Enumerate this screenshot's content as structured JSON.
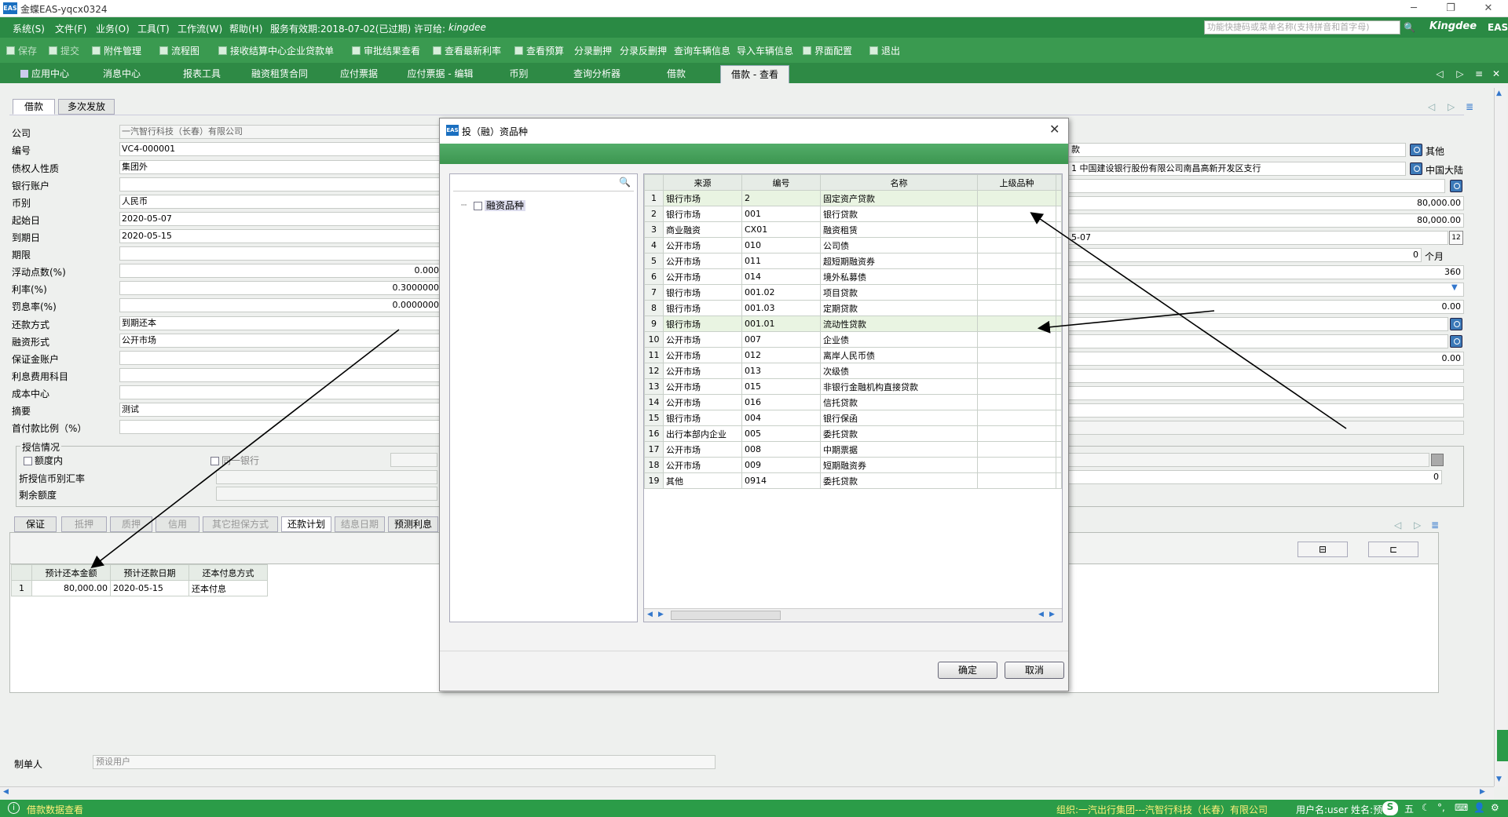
{
  "window": {
    "title": "金蝶EAS-yqcx0324"
  },
  "menu": {
    "items": [
      "系统(S)",
      "文件(F)",
      "业务(O)",
      "工具(T)",
      "工作流(W)",
      "帮助(H)"
    ],
    "service": "服务有效期:2018-07-02(已过期) 许可给:",
    "licensee": "kingdee",
    "search_placeholder": "功能快捷码或菜单名称(支持拼音和首字母)",
    "brand": "Kingdee",
    "brand_suffix": "EAS"
  },
  "toolbar": {
    "items": [
      {
        "label": "保存",
        "enabled": false
      },
      {
        "label": "提交",
        "enabled": false
      },
      {
        "label": "附件管理",
        "enabled": true
      },
      {
        "label": "流程图",
        "enabled": true
      },
      {
        "label": "接收结算中心企业贷款单",
        "enabled": true
      },
      {
        "label": "审批结果查看",
        "enabled": true
      },
      {
        "label": "查看最新利率",
        "enabled": true
      },
      {
        "label": "查看预算",
        "enabled": true
      },
      {
        "label": "分录删押",
        "enabled": true
      },
      {
        "label": "分录反删押",
        "enabled": true
      },
      {
        "label": "查询车辆信息",
        "enabled": true
      },
      {
        "label": "导入车辆信息",
        "enabled": true
      },
      {
        "label": "界面配置",
        "enabled": true
      },
      {
        "label": "退出",
        "enabled": true
      }
    ]
  },
  "tabs": [
    "应用中心",
    "消息中心",
    "报表工具",
    "融资租赁合同",
    "应付票据",
    "应付票据 - 编辑",
    "币别",
    "查询分析器",
    "借款",
    "借款 - 查看"
  ],
  "active_tab": "借款 - 查看",
  "subtabs": [
    "借款",
    "多次发放"
  ],
  "form": {
    "fields": [
      {
        "label": "公司",
        "value": "一汽智行科技（长春）有限公司"
      },
      {
        "label": "编号",
        "value": "VC4-000001"
      },
      {
        "label": "债权人性质",
        "value": "集团外"
      },
      {
        "label": "银行账户",
        "value": ""
      },
      {
        "label": "币别",
        "value": "人民币"
      },
      {
        "label": "起始日",
        "value": "2020-05-07"
      },
      {
        "label": "到期日",
        "value": "2020-05-15"
      },
      {
        "label": "期限",
        "value": ""
      },
      {
        "label": "浮动点数(%)",
        "value": "0.000"
      },
      {
        "label": "利率(%)",
        "value": "0.3000000"
      },
      {
        "label": "罚息率(%)",
        "value": "0.0000000"
      },
      {
        "label": "还款方式",
        "value": "到期还本"
      },
      {
        "label": "融资形式",
        "value": "公开市场"
      },
      {
        "label": "保证金账户",
        "value": ""
      },
      {
        "label": "利息费用科目",
        "value": ""
      },
      {
        "label": "成本中心",
        "value": ""
      },
      {
        "label": "摘要",
        "value": "测试"
      },
      {
        "label": "首付款比例（%）",
        "value": ""
      }
    ],
    "right": {
      "row1": "款",
      "row1_tag": "其他",
      "row2": "1 中国建设银行股份有限公司南昌高新开发区支行",
      "row2_tag": "中国大陆",
      "amount1": "80,000.00",
      "amount2": "80,000.00",
      "date": "5-07",
      "months": "0",
      "months_unit": "个月",
      "days": "360",
      "rate": "0.00",
      "amount3": "0.00",
      "credit_count": "0"
    },
    "credit": {
      "title": "授信情况",
      "in_limit": "额度内",
      "same_bank": "同一银行",
      "rate_label": "折授信币别汇率",
      "remain_label": "剩余额度"
    },
    "bottom_tabs": [
      "保证",
      "抵押",
      "质押",
      "信用",
      "其它担保方式",
      "还款计划",
      "结息日期",
      "预测利息"
    ],
    "plan": {
      "headers": [
        "预计还本金额",
        "预计还款日期",
        "还本付息方式"
      ],
      "rows": [
        [
          "1",
          "80,000.00",
          "2020-05-15",
          "还本付息"
        ]
      ]
    },
    "creator_label": "制单人",
    "creator_value": "预设用户"
  },
  "dialog": {
    "title": "投（融）资品种",
    "tree_root": "融资品种",
    "columns": [
      "来源",
      "编号",
      "名称",
      "上级品种"
    ],
    "rows": [
      [
        "1",
        "银行市场",
        "2",
        "固定资产贷款",
        ""
      ],
      [
        "2",
        "银行市场",
        "001",
        "银行贷款",
        ""
      ],
      [
        "3",
        "商业融资",
        "CX01",
        "融资租赁",
        ""
      ],
      [
        "4",
        "公开市场",
        "010",
        "公司债",
        ""
      ],
      [
        "5",
        "公开市场",
        "011",
        "超短期融资券",
        ""
      ],
      [
        "6",
        "公开市场",
        "014",
        "境外私募债",
        ""
      ],
      [
        "7",
        "银行市场",
        "001.02",
        "项目贷款",
        ""
      ],
      [
        "8",
        "银行市场",
        "001.03",
        "定期贷款",
        ""
      ],
      [
        "9",
        "银行市场",
        "001.01",
        "流动性贷款",
        ""
      ],
      [
        "10",
        "公开市场",
        "007",
        "企业债",
        ""
      ],
      [
        "11",
        "公开市场",
        "012",
        "离岸人民币债",
        ""
      ],
      [
        "12",
        "公开市场",
        "013",
        "次级债",
        ""
      ],
      [
        "13",
        "公开市场",
        "015",
        "非银行金融机构直接贷款",
        ""
      ],
      [
        "14",
        "公开市场",
        "016",
        "信托贷款",
        ""
      ],
      [
        "15",
        "银行市场",
        "004",
        "银行保函",
        ""
      ],
      [
        "16",
        "出行本部内企业",
        "005",
        "委托贷款",
        ""
      ],
      [
        "17",
        "公开市场",
        "008",
        "中期票据",
        ""
      ],
      [
        "18",
        "公开市场",
        "009",
        "短期融资券",
        ""
      ],
      [
        "19",
        "其他",
        "0914",
        "委托贷款",
        ""
      ]
    ],
    "ok": "确定",
    "cancel": "取消"
  },
  "status": {
    "left": "借款数据查看",
    "org": "组织:一汽出行集团---汽智行科技（长春）有限公司",
    "user": "用户名:user 姓名:预",
    "ime": "五"
  },
  "colors": {
    "menu_green": "#2a8a44",
    "toolbar_green": "#3a9a50",
    "status_yellow": "#ffef7a"
  }
}
